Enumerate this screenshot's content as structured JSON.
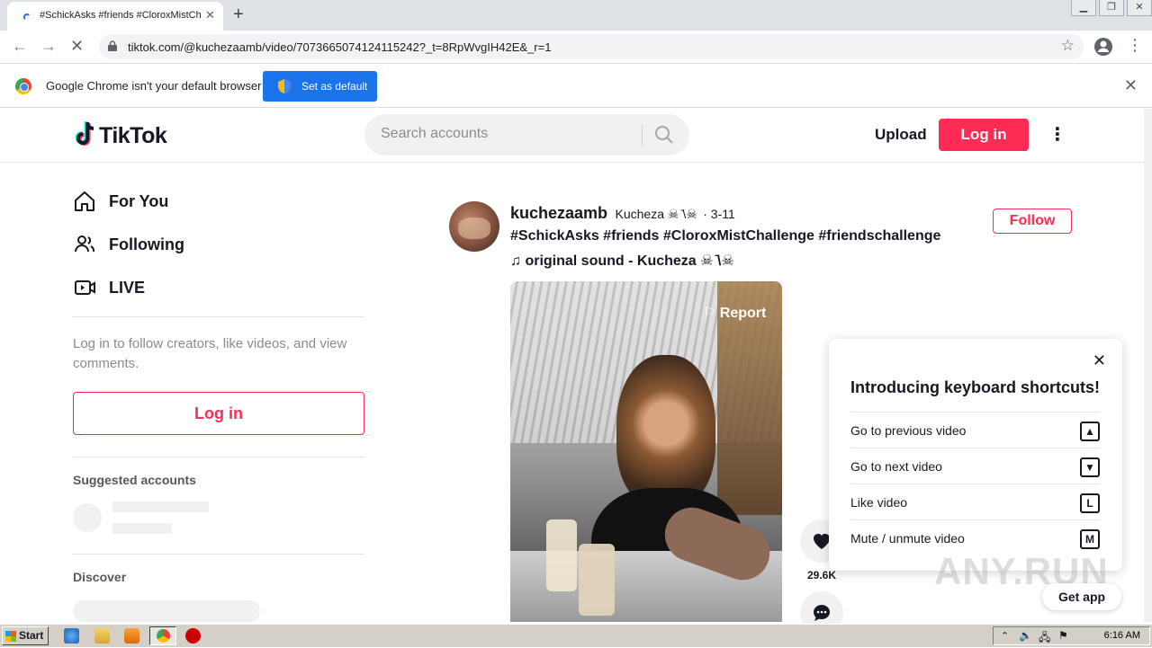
{
  "browser": {
    "tab_title": "#SchickAsks #friends #CloroxMistChallenge",
    "url": "tiktok.com/@kuchezaamb/video/7073665074124115242?_t=8RpWvgIH42E&_r=1",
    "infobar_text": "Google Chrome isn't your default browser",
    "set_default_label": "Set as default"
  },
  "header": {
    "logo_text": "TikTok",
    "search_placeholder": "Search accounts",
    "upload_label": "Upload",
    "login_label": "Log in"
  },
  "sidebar": {
    "nav": [
      {
        "label": "For You",
        "icon": "home-icon"
      },
      {
        "label": "Following",
        "icon": "users-icon"
      },
      {
        "label": "LIVE",
        "icon": "live-icon"
      }
    ],
    "login_prompt": "Log in to follow creators, like videos, and view comments.",
    "login_label": "Log in",
    "suggested_heading": "Suggested accounts",
    "discover_heading": "Discover"
  },
  "post": {
    "username": "kuchezaamb",
    "nickname": "Kucheza ☠︎ ̄\\☠",
    "date": "· 3-11",
    "caption": "#SchickAsks #friends #CloroxMistChallenge #friendschallenge",
    "sound": "original sound - Kucheza ☠︎ ̄\\☠",
    "follow_label": "Follow",
    "report_label": "Report",
    "like_count": "29.6K"
  },
  "shortcuts": {
    "title": "Introducing keyboard shortcuts!",
    "items": [
      {
        "label": "Go to previous video",
        "key": "▲"
      },
      {
        "label": "Go to next video",
        "key": "▼"
      },
      {
        "label": "Like video",
        "key": "L"
      },
      {
        "label": "Mute / unmute video",
        "key": "M"
      }
    ]
  },
  "get_app_label": "Get app",
  "watermark": "ANY.RUN",
  "taskbar": {
    "start_label": "Start",
    "clock": "6:16 AM"
  },
  "colors": {
    "accent": "#fe2c55",
    "chrome_blue": "#1a73e8"
  }
}
